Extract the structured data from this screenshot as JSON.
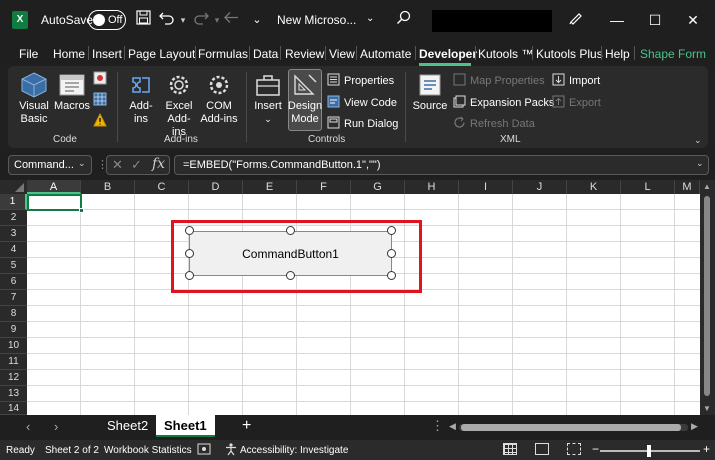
{
  "titlebar": {
    "app_icon": "excel-logo-icon",
    "app_icon_letter": "X",
    "autosave_label": "AutoSave",
    "autosave_state": "Off",
    "doc_title": "New Microso...",
    "window_controls": [
      "minimize-icon",
      "maximize-icon",
      "close-icon"
    ]
  },
  "tabs": [
    "File",
    "Home",
    "Insert",
    "Page Layout",
    "Formulas",
    "Data",
    "Review",
    "View",
    "Automate",
    "Developer",
    "Kutools ™",
    "Kutools Plus",
    "Help",
    "Shape Form"
  ],
  "active_tab": "Developer",
  "accent_color": "#4cc38a",
  "ribbon": {
    "code": {
      "label": "Code",
      "visual_basic": "Visual Basic",
      "macros": "Macros"
    },
    "addins": {
      "label": "Add-ins",
      "addins": "Add-ins",
      "excel_addins": "Excel Add-ins",
      "com_addins": "COM Add-ins"
    },
    "controls": {
      "label": "Controls",
      "insert": "Insert",
      "design_mode": "Design Mode",
      "properties": "Properties",
      "view_code": "View Code",
      "run_dialog": "Run Dialog"
    },
    "xml": {
      "label": "XML",
      "source": "Source",
      "map_properties": "Map Properties",
      "expansion_packs": "Expansion Packs",
      "refresh_data": "Refresh Data",
      "import": "Import",
      "export": "Export"
    }
  },
  "formula_bar": {
    "name_box": "Command...",
    "fx": "fx",
    "formula": "=EMBED(\"Forms.CommandButton.1\",\"\")"
  },
  "grid": {
    "columns": [
      "A",
      "B",
      "C",
      "D",
      "E",
      "F",
      "G",
      "H",
      "I",
      "J",
      "K",
      "L",
      "M"
    ],
    "rows": [
      "1",
      "2",
      "3",
      "4",
      "5",
      "6",
      "7",
      "8",
      "9",
      "10",
      "11",
      "12",
      "13",
      "14"
    ],
    "selected_column": "A",
    "selected_row": "1"
  },
  "command_button": {
    "caption": "CommandButton1",
    "highlight_color": "#e0141e"
  },
  "sheet_tabs": {
    "sheets": [
      "Sheet2",
      "Sheet1"
    ],
    "active": "Sheet1",
    "add_label": "+",
    "more_label": "⋮"
  },
  "statusbar": {
    "ready": "Ready",
    "sheet_info": "Sheet 2 of 2",
    "workbook_statistics": "Workbook Statistics",
    "accessibility": "Accessibility: Investigate",
    "zoom_minus": "−",
    "zoom_plus": "+"
  }
}
